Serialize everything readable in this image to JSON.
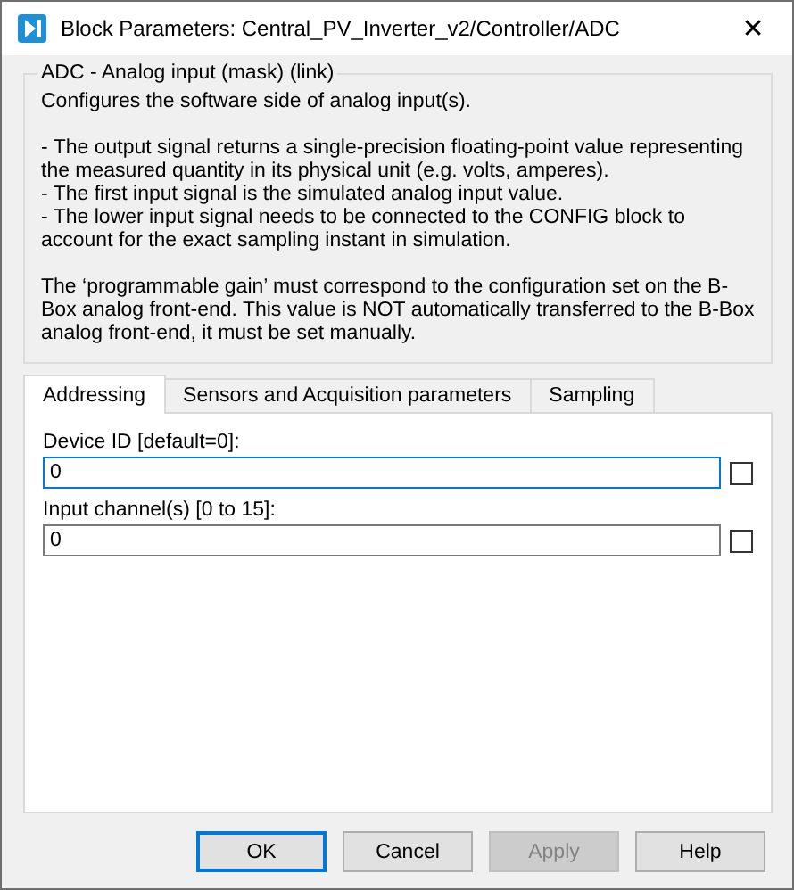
{
  "window": {
    "title": "Block Parameters: Central_PV_Inverter_v2/Controller/ADC",
    "close": "✕"
  },
  "group": {
    "title": "ADC - Analog input (mask) (link)",
    "paragraphs": [
      {
        "lines": [
          "Configures the software side of analog input(s)."
        ]
      },
      {
        "lines": [
          "- The output signal returns a single-precision floating-point value representing the measured quantity in its physical unit (e.g. volts, amperes).",
          "- The first input signal is the simulated analog input value.",
          "- The lower input signal needs to be connected to the CONFIG block to account for the exact sampling instant in simulation."
        ]
      },
      {
        "lines": [
          "The ‘programmable gain’ must correspond to the configuration set on the B-Box analog front-end. This value is NOT automatically transferred to the B-Box analog front-end, it must be set manually."
        ]
      }
    ]
  },
  "tabs": [
    {
      "label": "Addressing",
      "selected": true
    },
    {
      "label": "Sensors and Acquisition parameters",
      "selected": false
    },
    {
      "label": "Sampling",
      "selected": false
    }
  ],
  "params": [
    {
      "label": "Device ID [default=0]:",
      "value": "0",
      "focused": true,
      "checked": false
    },
    {
      "label": "Input channel(s) [0 to 15]:",
      "value": "0",
      "focused": false,
      "checked": false
    }
  ],
  "buttons": [
    {
      "label": "OK",
      "default": true,
      "disabled": false
    },
    {
      "label": "Cancel",
      "default": false,
      "disabled": false
    },
    {
      "label": "Apply",
      "default": false,
      "disabled": true
    },
    {
      "label": "Help",
      "default": false,
      "disabled": false
    }
  ]
}
